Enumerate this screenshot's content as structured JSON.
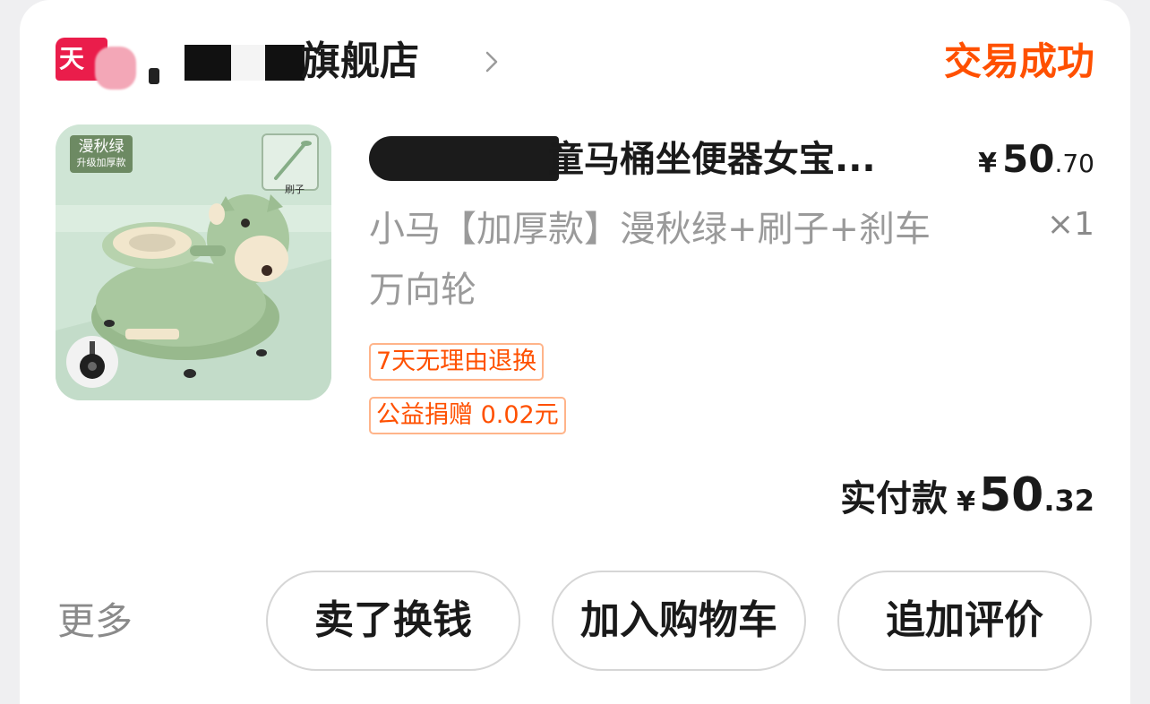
{
  "shop": {
    "logo_text": "天猫",
    "name_visible": "旗舰店",
    "status": "交易成功"
  },
  "product": {
    "title_visible": "童马桶坐便器女宝...",
    "unit_price": {
      "currency": "¥",
      "integer": "50",
      "decimal": ".70"
    },
    "sku": "小马【加厚款】漫秋绿+刷子+刹车万向轮",
    "quantity": "×1",
    "image": {
      "tag_main": "漫秋绿",
      "tag_sub": "升级加厚款",
      "brush_label": "刷子"
    },
    "tags": [
      "7天无理由退换",
      "公益捐赠 0.02元"
    ]
  },
  "total": {
    "label": "实付款",
    "currency": "¥",
    "integer": "50",
    "decimal": ".32"
  },
  "actions": {
    "more": "更多",
    "sell": "卖了换钱",
    "add_to_cart": "加入购物车",
    "review": "追加评价"
  },
  "colors": {
    "accent": "#ff5000",
    "tmall_red": "#ea1d4b",
    "text_primary": "#1a1a1a",
    "text_secondary": "#9a9a9a",
    "product_green": "#a9c89f"
  },
  "icons": {
    "shop_chevron": "chevron-right-icon",
    "logo": "tmall-logo-icon"
  }
}
